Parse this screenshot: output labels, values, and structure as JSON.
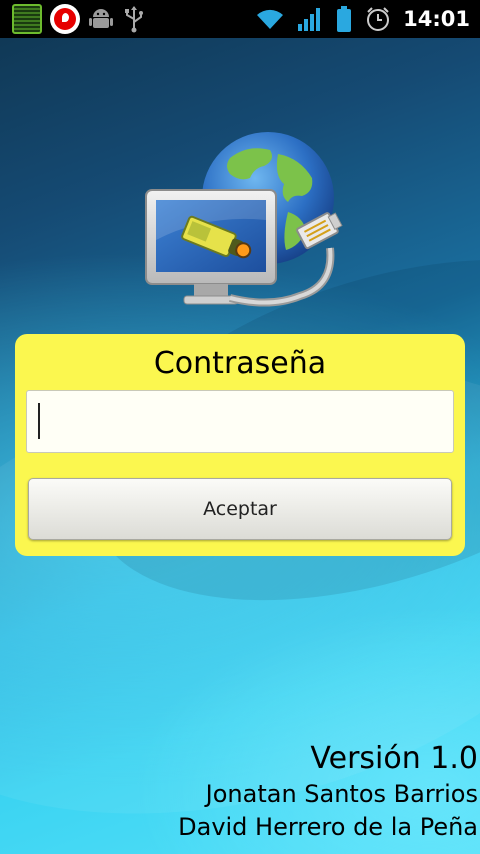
{
  "status_bar": {
    "time": "14:01",
    "left_icons": [
      "app-grid-icon",
      "vodafone-icon",
      "android-debug-icon",
      "usb-icon"
    ],
    "right_icons": [
      "wifi-icon",
      "signal-icon",
      "battery-icon",
      "alarm-icon"
    ]
  },
  "login": {
    "title": "Contraseña",
    "password_value": "",
    "submit_label": "Aceptar"
  },
  "footer": {
    "version": "Versión 1.0",
    "authors": [
      "Jonatan Santos Barrios",
      "David Herrero de la Peña"
    ]
  },
  "colors": {
    "card": "#fbf74f",
    "statusbar": "#000000",
    "accent_green": "#6dbb2e"
  }
}
